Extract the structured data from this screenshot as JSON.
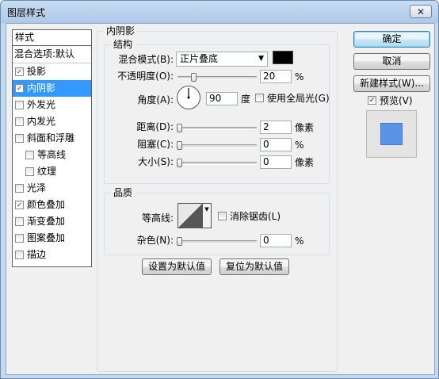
{
  "window": {
    "title": "图层样式",
    "close_glyph": "✕"
  },
  "style_list": {
    "header": "样式",
    "blend_options": "混合选项:默认",
    "items": [
      {
        "label": "投影",
        "checked": true,
        "selected": false,
        "indent": false
      },
      {
        "label": "内阴影",
        "checked": true,
        "selected": true,
        "indent": false
      },
      {
        "label": "外发光",
        "checked": false,
        "selected": false,
        "indent": false
      },
      {
        "label": "内发光",
        "checked": false,
        "selected": false,
        "indent": false
      },
      {
        "label": "斜面和浮雕",
        "checked": false,
        "selected": false,
        "indent": false
      },
      {
        "label": "等高线",
        "checked": false,
        "selected": false,
        "indent": true
      },
      {
        "label": "纹理",
        "checked": false,
        "selected": false,
        "indent": true
      },
      {
        "label": "光泽",
        "checked": false,
        "selected": false,
        "indent": false
      },
      {
        "label": "颜色叠加",
        "checked": true,
        "selected": false,
        "indent": false
      },
      {
        "label": "渐变叠加",
        "checked": false,
        "selected": false,
        "indent": false
      },
      {
        "label": "图案叠加",
        "checked": false,
        "selected": false,
        "indent": false
      },
      {
        "label": "描边",
        "checked": false,
        "selected": false,
        "indent": false
      }
    ]
  },
  "inner_shadow": {
    "title": "内阴影",
    "structure": {
      "title": "结构",
      "blend_mode_label": "混合模式(B):",
      "blend_mode_value": "正片叠底",
      "blend_color": "#000000",
      "opacity_label": "不透明度(O):",
      "opacity_value": "20",
      "opacity_unit": "%",
      "angle_label": "角度(A):",
      "angle_value": "90",
      "angle_unit": "度",
      "global_light_label": "使用全局光(G)",
      "global_light_checked": false,
      "distance_label": "距离(D):",
      "distance_value": "2",
      "distance_unit": "像素",
      "choke_label": "阻塞(C):",
      "choke_value": "0",
      "choke_unit": "%",
      "size_label": "大小(S):",
      "size_value": "0",
      "size_unit": "像素"
    },
    "quality": {
      "title": "品质",
      "contour_label": "等高线:",
      "anti_alias_label": "消除锯齿(L)",
      "anti_alias_checked": false,
      "noise_label": "杂色(N):",
      "noise_value": "0",
      "noise_unit": "%"
    },
    "make_default_label": "设置为默认值",
    "reset_default_label": "复位为默认值"
  },
  "actions": {
    "ok_label": "确定",
    "cancel_label": "取消",
    "new_style_label": "新建样式(W)...",
    "preview_label": "预览(V)",
    "preview_checked": true,
    "preview_swatch_color": "#5b93e6"
  }
}
